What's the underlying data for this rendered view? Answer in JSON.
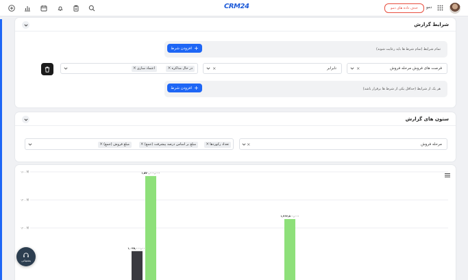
{
  "topbar": {
    "logo": "CRM24",
    "demo_button": "حذف داده های دمو",
    "user_name": "دمو",
    "icons": [
      "add-circle-icon",
      "chart-icon",
      "calendar-icon",
      "bell-icon",
      "clipboard-icon",
      "search-icon",
      "grid-icon"
    ]
  },
  "conditions": {
    "title": "شرایط گزارش",
    "all_text": "تمام شرایط (تمام شرط ها باید رعایت شوند)",
    "any_text": "هر یک از شرایط (حداقل یکی از شرط ها برقرار باشد)",
    "add_label": "افزودن شرط",
    "rule": {
      "field": "فرصت های فروش مرحله فروش",
      "operator": "نابرابر",
      "values": [
        "در حال مذاکره",
        "اعتماد سازی"
      ]
    }
  },
  "columns": {
    "title": "ستون های گزارش",
    "group_by": "مرحله فروش",
    "values": [
      "تعداد رکوردها",
      "مبلغ بر اساس درصد پیشرفت (جمع)",
      "مبلغ فروش (جمع)"
    ]
  },
  "chart_data": {
    "type": "bar",
    "y_ticks": [
      "۱۶۰۰M",
      "۱۴۰۰M",
      "۱۲۰۰M"
    ],
    "bars": [
      {
        "label": "۱,۰۳۵,۰۰۰,۰۰۰",
        "value": 1035000000,
        "color": "#3a3a40"
      },
      {
        "label": "۱,۵۷۰,۰۰۰,۰۰۰",
        "value": 1570000000,
        "color": "#8ee07a"
      },
      {
        "label": "۱,۲۶۳,۵۰۰,۰۰۰",
        "value": 1263500000,
        "color": "#8ee07a"
      }
    ]
  },
  "support": {
    "label": "پشتیبانی"
  }
}
